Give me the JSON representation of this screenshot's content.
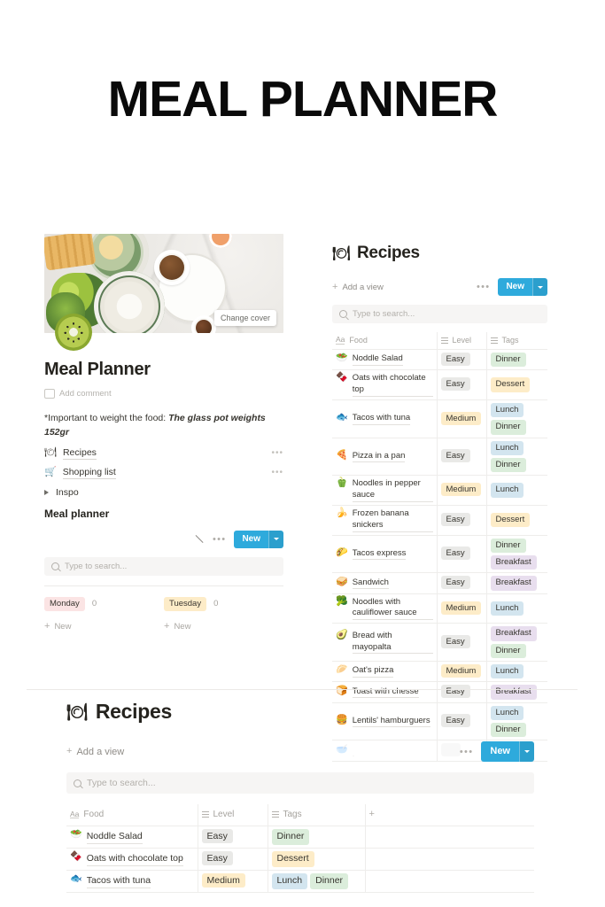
{
  "page": {
    "title": "MEAL PLANNER"
  },
  "cover": {
    "change_cover_label": "Change cover",
    "icon": "kiwi-emoji"
  },
  "doc": {
    "title": "Meal Planner",
    "add_comment_label": "Add comment",
    "note_prefix": "*Important to weight the food: ",
    "note_emphasis": "The glass pot weights 152gr",
    "links": [
      {
        "icon": "🍽",
        "label": "Recipes",
        "menu": "•••"
      },
      {
        "icon": "🛒",
        "label": "Shopping list",
        "menu": "•••"
      }
    ],
    "toggle": {
      "label": "Inspo"
    },
    "section_title": "Meal planner"
  },
  "board": {
    "expand_icon": "expand-icon",
    "more_label": "•••",
    "new_label": "New",
    "search_placeholder": "Type to search...",
    "columns": [
      {
        "name": "Monday",
        "count": "0",
        "color": "#fbe4e4",
        "new_label": "New"
      },
      {
        "name": "Tuesday",
        "count": "0",
        "color": "#fdecc8",
        "new_label": "New"
      }
    ]
  },
  "recipes_small": {
    "icon": "🍽",
    "title": "Recipes",
    "add_view_label": "Add a view",
    "more_label": "•••",
    "new_label": "New",
    "search_placeholder": "Type to search...",
    "columns": [
      {
        "key": "food",
        "label": "Food",
        "icon": "aa-icon"
      },
      {
        "key": "level",
        "label": "Level",
        "icon": "list-icon"
      },
      {
        "key": "tags",
        "label": "Tags",
        "icon": "list-icon"
      }
    ],
    "rows": [
      {
        "emoji": "🥗",
        "food": "Noddle Salad",
        "level": "Easy",
        "tags": [
          "Dinner"
        ]
      },
      {
        "emoji": "🍫",
        "food": "Oats with chocolate top",
        "level": "Easy",
        "tags": [
          "Dessert"
        ]
      },
      {
        "emoji": "🐟",
        "food": "Tacos with tuna",
        "level": "Medium",
        "tags": [
          "Lunch",
          "Dinner"
        ]
      },
      {
        "emoji": "🍕",
        "food": "Pizza in a pan",
        "level": "Easy",
        "tags": [
          "Lunch",
          "Dinner"
        ]
      },
      {
        "emoji": "🫑",
        "food": "Noodles in pepper sauce",
        "level": "Medium",
        "tags": [
          "Lunch"
        ]
      },
      {
        "emoji": "🍌",
        "food": "Frozen banana snickers",
        "level": "Easy",
        "tags": [
          "Dessert"
        ]
      },
      {
        "emoji": "🌮",
        "food": "Tacos express",
        "level": "Easy",
        "tags": [
          "Dinner",
          "Breakfast"
        ]
      },
      {
        "emoji": "🥪",
        "food": "Sandwich",
        "level": "Easy",
        "tags": [
          "Breakfast"
        ]
      },
      {
        "emoji": "🥦",
        "food": "Noodles with cauliflower sauce",
        "level": "Medium",
        "tags": [
          "Lunch"
        ]
      },
      {
        "emoji": "🥑",
        "food": "Bread with mayopalta",
        "level": "Easy",
        "tags": [
          "Breakfast",
          "Dinner"
        ]
      },
      {
        "emoji": "🥟",
        "food": "Oat's pizza",
        "level": "Medium",
        "tags": [
          "Lunch"
        ]
      },
      {
        "emoji": "🍞",
        "food": "Toast with chesse",
        "level": "Easy",
        "tags": [
          "Breakfast"
        ]
      },
      {
        "emoji": "🍔",
        "food": "Lentils' hamburguers",
        "level": "Easy",
        "tags": [
          "Lunch",
          "Dinner"
        ]
      }
    ]
  },
  "recipes_large": {
    "icon": "🍽",
    "title": "Recipes",
    "add_view_label": "Add a view",
    "more_label": "•••",
    "new_label": "New",
    "search_placeholder": "Type to search...",
    "columns": [
      {
        "key": "food",
        "label": "Food",
        "icon": "aa-icon"
      },
      {
        "key": "level",
        "label": "Level",
        "icon": "list-icon"
      },
      {
        "key": "tags",
        "label": "Tags",
        "icon": "list-icon"
      },
      {
        "key": "add",
        "label": "+",
        "icon": "plus-icon"
      }
    ],
    "rows": [
      {
        "emoji": "🥗",
        "food": "Noddle Salad",
        "level": "Easy",
        "tags": [
          "Dinner"
        ]
      },
      {
        "emoji": "🍫",
        "food": "Oats with chocolate top",
        "level": "Easy",
        "tags": [
          "Dessert"
        ]
      },
      {
        "emoji": "🐟",
        "food": "Tacos with tuna",
        "level": "Medium",
        "tags": [
          "Lunch",
          "Dinner"
        ]
      }
    ]
  },
  "colors": {
    "accent": "#2eaadc",
    "level_easy_bg": "#e9e9e7",
    "level_medium_bg": "#fdecc8",
    "tag_dinner_bg": "#dbeddb",
    "tag_dessert_bg": "#fdecc8",
    "tag_lunch_bg": "#d3e5ef",
    "tag_breakfast_bg": "#e8deee"
  }
}
